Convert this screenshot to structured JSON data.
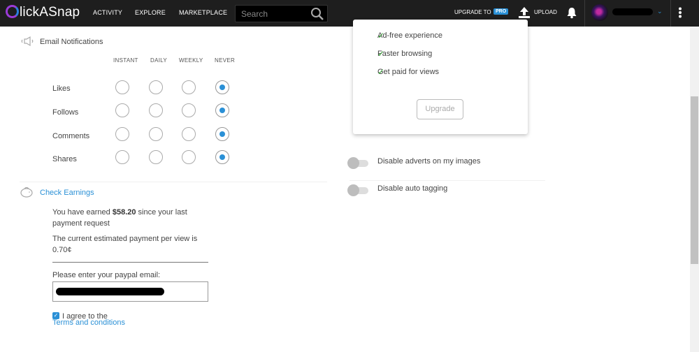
{
  "brand": {
    "logo_text": "lickASnap"
  },
  "nav": {
    "activity": "ACTIVITY",
    "explore": "EXPLORE",
    "marketplace": "MARKETPLACE"
  },
  "search": {
    "placeholder": "Search"
  },
  "header": {
    "upgrade_to": "UPGRADE TO",
    "pro_badge": "PRO",
    "upload": "UPLOAD",
    "accent_color": "#2a90d6"
  },
  "email_notifications": {
    "title": "Email Notifications",
    "columns": [
      "INSTANT",
      "DAILY",
      "WEEKLY",
      "NEVER"
    ],
    "rows": [
      {
        "label": "Likes",
        "selected": "NEVER"
      },
      {
        "label": "Follows",
        "selected": "NEVER"
      },
      {
        "label": "Comments",
        "selected": "NEVER"
      },
      {
        "label": "Shares",
        "selected": "NEVER"
      }
    ]
  },
  "earnings": {
    "title": "Check Earnings",
    "earned_prefix": "You have earned ",
    "earned_amount": "$58.20",
    "earned_suffix": " since your last payment request",
    "per_view_text": "The current estimated payment per view is 0.70¢",
    "paypal_label": "Please enter your paypal email:",
    "agree_text": "I agree to the",
    "terms_link": "Terms and conditions",
    "agree_checked": true
  },
  "pro_card": {
    "features": [
      "Ad-free experience",
      "Faster browsing",
      "Get paid for views"
    ],
    "upgrade_button": "Upgrade"
  },
  "settings": {
    "disable_adverts": {
      "label": "Disable adverts on my images",
      "on": false
    },
    "disable_auto_tagging": {
      "label": "Disable auto tagging",
      "on": false
    }
  }
}
